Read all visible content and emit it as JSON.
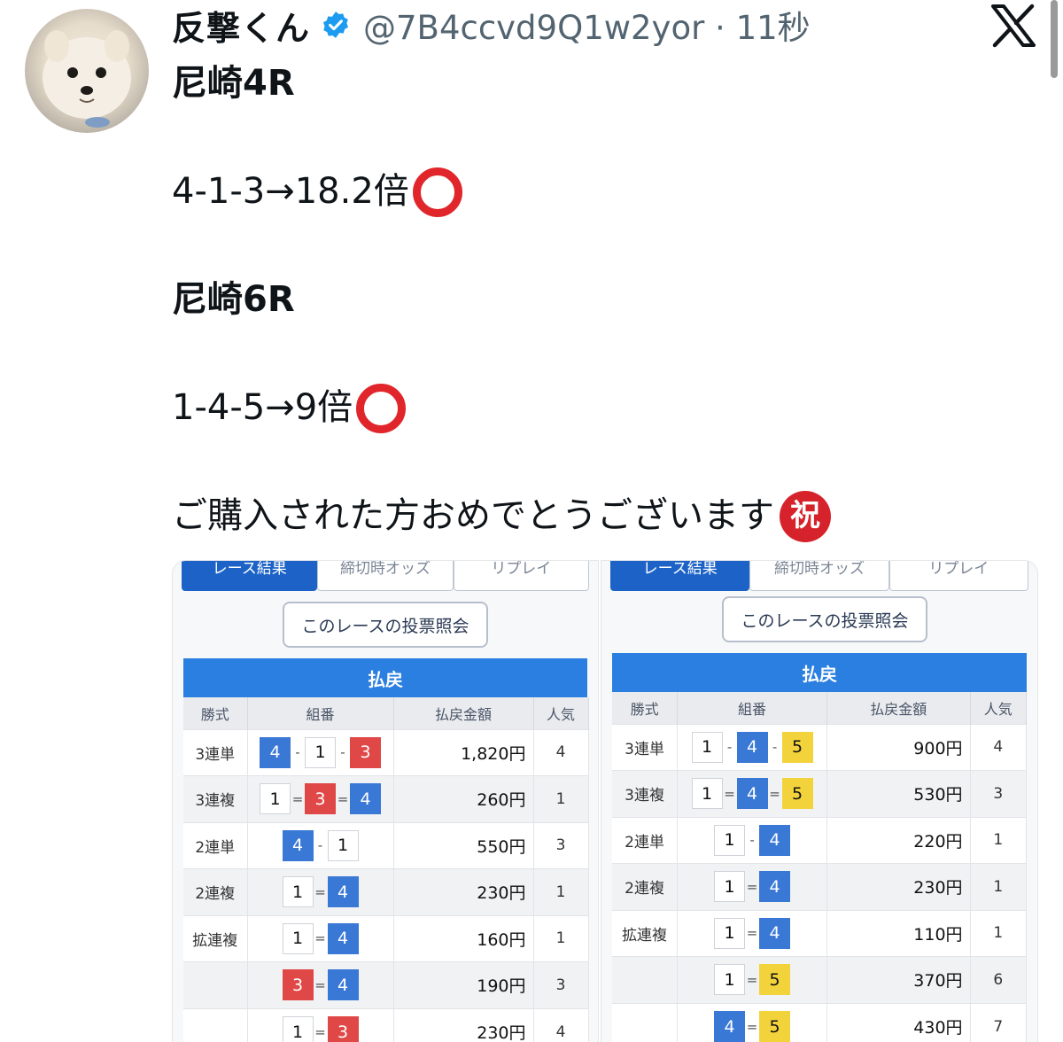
{
  "author": {
    "display_name": "反撃くん",
    "handle_time": "@7B4ccvd9Q1w2yor · 11秒"
  },
  "icons": {
    "avatar": "pomeranian-photo",
    "verified": "verified-badge-icon",
    "logo": "x-logo-icon",
    "check": "red-circle-emoji",
    "celebrate": "congratulations-emoji"
  },
  "tweet": {
    "line1": "尼崎4R",
    "line2": "4-1-3→18.2倍",
    "line3": "尼崎6R",
    "line4": "1-4-5→9倍",
    "line5": "ご購入された方おめでとうございます",
    "iwai_char": "祝"
  },
  "colors": {
    "boat1": "#ffffff",
    "boat3": "#e04848",
    "boat4": "#3a78d6",
    "boat5": "#f3d33c",
    "header_blue": "#2b7fe0",
    "check_red": "#e0262b"
  },
  "panels": [
    {
      "tabs": [
        "レース結果",
        "締切時オッズ",
        "リプレイ"
      ],
      "inquiry_button": "このレースの投票照会",
      "payout_title": "払戻",
      "columns": [
        "勝式",
        "組番",
        "払戻金額",
        "人気"
      ],
      "rows": [
        {
          "type": "3連単",
          "combo": [
            {
              "n": "4",
              "c": "boat4"
            },
            {
              "sep": "-"
            },
            {
              "n": "1",
              "c": "boat1"
            },
            {
              "sep": "-"
            },
            {
              "n": "3",
              "c": "boat3"
            }
          ],
          "amount": "1,820円",
          "pop": "4"
        },
        {
          "type": "3連複",
          "combo": [
            {
              "n": "1",
              "c": "boat1"
            },
            {
              "sep": "="
            },
            {
              "n": "3",
              "c": "boat3"
            },
            {
              "sep": "="
            },
            {
              "n": "4",
              "c": "boat4"
            }
          ],
          "amount": "260円",
          "pop": "1"
        },
        {
          "type": "2連単",
          "combo": [
            {
              "n": "4",
              "c": "boat4"
            },
            {
              "sep": "-"
            },
            {
              "n": "1",
              "c": "boat1"
            }
          ],
          "amount": "550円",
          "pop": "3"
        },
        {
          "type": "2連複",
          "combo": [
            {
              "n": "1",
              "c": "boat1"
            },
            {
              "sep": "="
            },
            {
              "n": "4",
              "c": "boat4"
            }
          ],
          "amount": "230円",
          "pop": "1"
        },
        {
          "type": "拡連複",
          "combo": [
            {
              "n": "1",
              "c": "boat1"
            },
            {
              "sep": "="
            },
            {
              "n": "4",
              "c": "boat4"
            }
          ],
          "amount": "160円",
          "pop": "1"
        },
        {
          "type": "",
          "combo": [
            {
              "n": "3",
              "c": "boat3"
            },
            {
              "sep": "="
            },
            {
              "n": "4",
              "c": "boat4"
            }
          ],
          "amount": "190円",
          "pop": "3"
        },
        {
          "type": "",
          "combo": [
            {
              "n": "1",
              "c": "boat1"
            },
            {
              "sep": "="
            },
            {
              "n": "3",
              "c": "boat3"
            }
          ],
          "amount": "230円",
          "pop": "4"
        }
      ]
    },
    {
      "tabs": [
        "レース結果",
        "締切時オッズ",
        "リプレイ"
      ],
      "inquiry_button": "このレースの投票照会",
      "payout_title": "払戻",
      "columns": [
        "勝式",
        "組番",
        "払戻金額",
        "人気"
      ],
      "rows": [
        {
          "type": "3連単",
          "combo": [
            {
              "n": "1",
              "c": "boat1"
            },
            {
              "sep": "-"
            },
            {
              "n": "4",
              "c": "boat4"
            },
            {
              "sep": "-"
            },
            {
              "n": "5",
              "c": "boat5"
            }
          ],
          "amount": "900円",
          "pop": "4"
        },
        {
          "type": "3連複",
          "combo": [
            {
              "n": "1",
              "c": "boat1"
            },
            {
              "sep": "="
            },
            {
              "n": "4",
              "c": "boat4"
            },
            {
              "sep": "="
            },
            {
              "n": "5",
              "c": "boat5"
            }
          ],
          "amount": "530円",
          "pop": "3"
        },
        {
          "type": "2連単",
          "combo": [
            {
              "n": "1",
              "c": "boat1"
            },
            {
              "sep": "-"
            },
            {
              "n": "4",
              "c": "boat4"
            }
          ],
          "amount": "220円",
          "pop": "1"
        },
        {
          "type": "2連複",
          "combo": [
            {
              "n": "1",
              "c": "boat1"
            },
            {
              "sep": "="
            },
            {
              "n": "4",
              "c": "boat4"
            }
          ],
          "amount": "230円",
          "pop": "1"
        },
        {
          "type": "拡連複",
          "combo": [
            {
              "n": "1",
              "c": "boat1"
            },
            {
              "sep": "="
            },
            {
              "n": "4",
              "c": "boat4"
            }
          ],
          "amount": "110円",
          "pop": "1"
        },
        {
          "type": "",
          "combo": [
            {
              "n": "1",
              "c": "boat1"
            },
            {
              "sep": "="
            },
            {
              "n": "5",
              "c": "boat5"
            }
          ],
          "amount": "370円",
          "pop": "6"
        },
        {
          "type": "",
          "combo": [
            {
              "n": "4",
              "c": "boat4"
            },
            {
              "sep": "="
            },
            {
              "n": "5",
              "c": "boat5"
            }
          ],
          "amount": "430円",
          "pop": "7"
        }
      ]
    }
  ]
}
